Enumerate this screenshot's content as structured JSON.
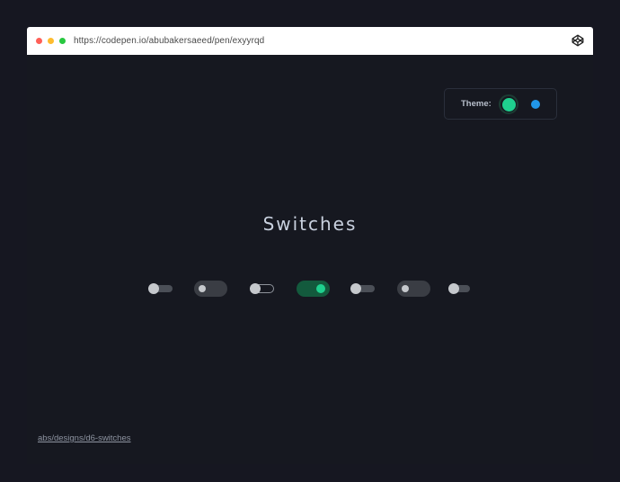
{
  "browser": {
    "url": "https://codepen.io/abubakersaeed/pen/exyyrqd",
    "icon": "codepen-icon"
  },
  "theme": {
    "label": "Theme:",
    "options": [
      {
        "name": "green",
        "color": "#1fcf8e",
        "selected": true
      },
      {
        "name": "blue",
        "color": "#2196e8",
        "selected": false
      }
    ]
  },
  "page": {
    "title": "Switches",
    "footer_link": "abs/designs/d6-switches"
  },
  "switches": [
    {
      "style": "thin-track",
      "on": false
    },
    {
      "style": "pill",
      "on": false
    },
    {
      "style": "outlined-track",
      "on": false
    },
    {
      "style": "pill",
      "on": true
    },
    {
      "style": "thin-track",
      "on": false
    },
    {
      "style": "pill",
      "on": false
    },
    {
      "style": "thin-track",
      "on": false
    }
  ],
  "colors": {
    "background": "#161820",
    "accent": "#1fcf8e",
    "accent_track": "#135a3d"
  }
}
